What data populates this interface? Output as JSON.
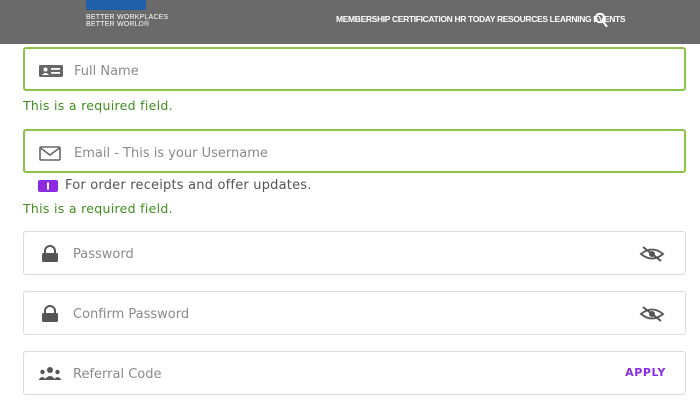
{
  "header": {
    "logo": {
      "tagline_1": "BETTER WORKPLACES",
      "tagline_2": "BETTER WORLD®"
    },
    "nav_text": "MEMBERSHIP CERTIFICATION HR TODAY RESOURCES LEARNING EVENTS",
    "search_icon": "search-icon"
  },
  "form": {
    "full_name": {
      "placeholder": "Full Name",
      "icon": "id-card-icon",
      "error": "This is a required field."
    },
    "email": {
      "placeholder": "Email - This is your Username",
      "icon": "envelope-icon",
      "note": "For order receipts and offer updates.",
      "note_icon": "info-badge-icon",
      "error": "This is a required field."
    },
    "password": {
      "placeholder": "Password",
      "icon": "lock-icon",
      "toggle_icon": "eye-slash-icon"
    },
    "confirm_password": {
      "placeholder": "Confirm Password",
      "icon": "lock-icon",
      "toggle_icon": "eye-slash-icon"
    },
    "referral": {
      "placeholder": "Referral Code",
      "icon": "users-icon",
      "apply_label": "APPLY"
    }
  },
  "colors": {
    "header_bg": "#6a6a6a",
    "logo_blue": "#1f5fa8",
    "valid_green": "#8bc34a",
    "error_green": "#3f8e1d",
    "accent_purple": "#8a2be2"
  }
}
